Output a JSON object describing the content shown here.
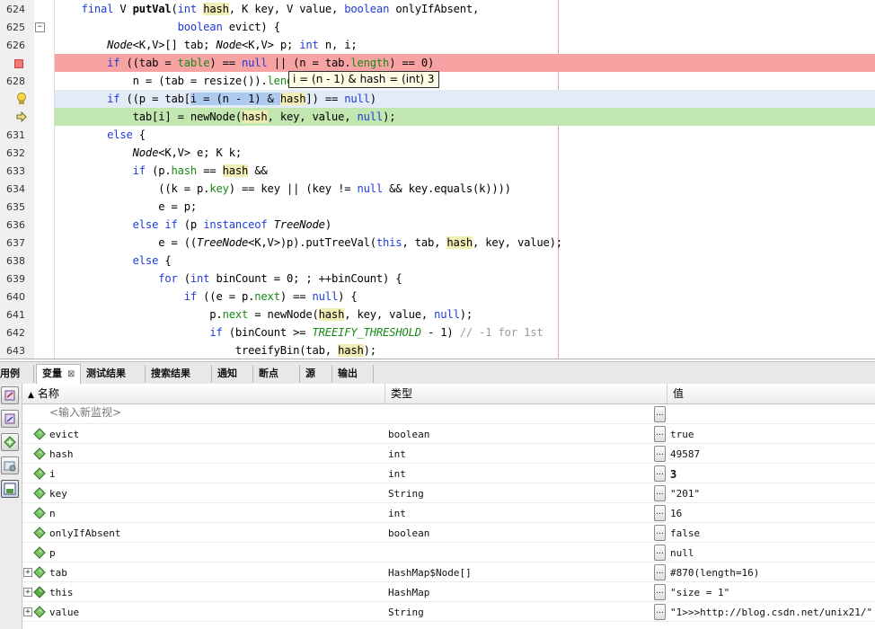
{
  "editor": {
    "lines": [
      {
        "n": "624",
        "t": "code"
      },
      {
        "n": "625",
        "t": "code"
      },
      {
        "n": "626",
        "t": "code"
      },
      {
        "n": "",
        "t": "breakpoint"
      },
      {
        "n": "628",
        "t": "code"
      },
      {
        "n": "",
        "t": "hint"
      },
      {
        "n": "",
        "t": "current"
      },
      {
        "n": "631",
        "t": "code"
      },
      {
        "n": "632",
        "t": "code"
      },
      {
        "n": "633",
        "t": "code"
      },
      {
        "n": "634",
        "t": "code"
      },
      {
        "n": "635",
        "t": "code"
      },
      {
        "n": "636",
        "t": "code"
      },
      {
        "n": "637",
        "t": "code"
      },
      {
        "n": "638",
        "t": "code"
      },
      {
        "n": "639",
        "t": "code"
      },
      {
        "n": "640",
        "t": "code"
      },
      {
        "n": "641",
        "t": "code"
      },
      {
        "n": "642",
        "t": "code"
      },
      {
        "n": "643",
        "t": "code"
      }
    ],
    "tooltip": "i = (n - 1) & hash = (int) 3",
    "highlight_colors": {
      "breakpoint": "#f8a3a3",
      "current": "#c2e6b0",
      "occurrence": "#f2edb4",
      "selection": "#aecbef"
    }
  },
  "tabs": [
    {
      "label": "用例"
    },
    {
      "label": "变量",
      "close": "⊠"
    },
    {
      "label": "测试结果"
    },
    {
      "label": "搜索结果"
    },
    {
      "label": "通知"
    },
    {
      "label": "断点"
    },
    {
      "label": "源"
    },
    {
      "label": "输出"
    }
  ],
  "variables": {
    "headers": {
      "name": "名称",
      "type": "类型",
      "value": "值"
    },
    "new_watch_placeholder": "<输入新监视>",
    "rows": [
      {
        "name": "evict",
        "type": "boolean",
        "value": "true",
        "expandable": false
      },
      {
        "name": "hash",
        "type": "int",
        "value": "49587",
        "expandable": false
      },
      {
        "name": "i",
        "type": "int",
        "value": "3",
        "bold": true,
        "expandable": false
      },
      {
        "name": "key",
        "type": "String",
        "value": "\"201\"",
        "expandable": false
      },
      {
        "name": "n",
        "type": "int",
        "value": "16",
        "expandable": false
      },
      {
        "name": "onlyIfAbsent",
        "type": "boolean",
        "value": "false",
        "expandable": false
      },
      {
        "name": "p",
        "type": "",
        "value": "null",
        "expandable": false
      },
      {
        "name": "tab",
        "type": "HashMap$Node[]",
        "value": "#870(length=16)",
        "expandable": true
      },
      {
        "name": "this",
        "type": "HashMap",
        "value": "\"size = 1\"",
        "expandable": true
      },
      {
        "name": "value",
        "type": "String",
        "value": "\"1>>>http://blog.csdn.net/unix21/\"",
        "expandable": true
      }
    ],
    "dots_label": "..."
  },
  "icons": {
    "left_toolbar": [
      "watch-add-icon",
      "watch-edit-icon",
      "new-watch-icon",
      "settings-icon",
      "variables-view-icon"
    ],
    "variable_icon": "variable-diamond-icon"
  }
}
